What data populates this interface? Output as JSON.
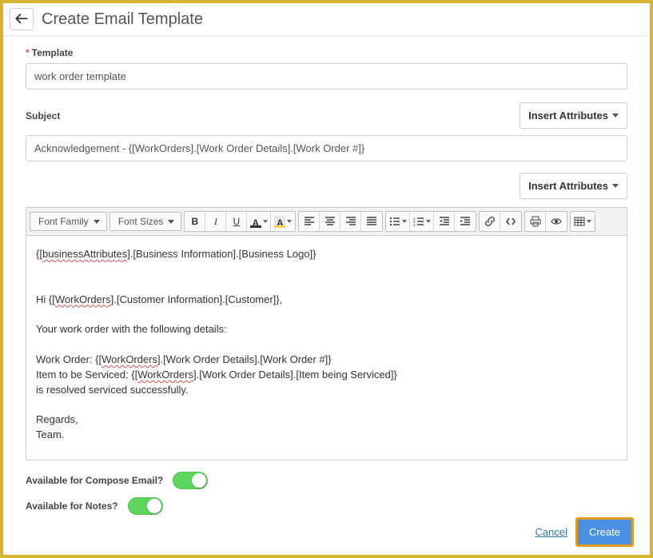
{
  "header": {
    "title": "Create Email Template"
  },
  "form": {
    "template_label": "Template",
    "template_value": "work order template",
    "subject_label": "Subject",
    "subject_value": "Acknowledgement - {[WorkOrders].[Work Order Details].[Work Order #]}",
    "insert_attributes_label": "Insert Attributes"
  },
  "toolbar": {
    "font_family": "Font Family",
    "font_sizes": "Font Sizes"
  },
  "editor": {
    "l1a": "{[",
    "l1b": "businessAttributes",
    "l1c": "].[Business Information].[Business Logo]}",
    "l2a": "Hi {[",
    "l2b": "WorkOrders",
    "l2c": "].[Customer Information].[Customer]},",
    "l3": "Your work order with the following details:",
    "l4a": "Work Order: {[",
    "l4b": "WorkOrders",
    "l4c": "].[Work Order Details].[Work Order #]}",
    "l5a": "Item to be Serviced: {[",
    "l5b": "WorkOrders",
    "l5c": "].[Work Order Details].[Item being Serviced]}",
    "l6": "is resolved serviced successfully.",
    "l7": "Regards,",
    "l8": "Team."
  },
  "options": {
    "compose_label": "Available for Compose Email?",
    "notes_label": "Available for Notes?",
    "compose_on": true,
    "notes_on": true
  },
  "footer": {
    "cancel": "Cancel",
    "create": "Create"
  }
}
